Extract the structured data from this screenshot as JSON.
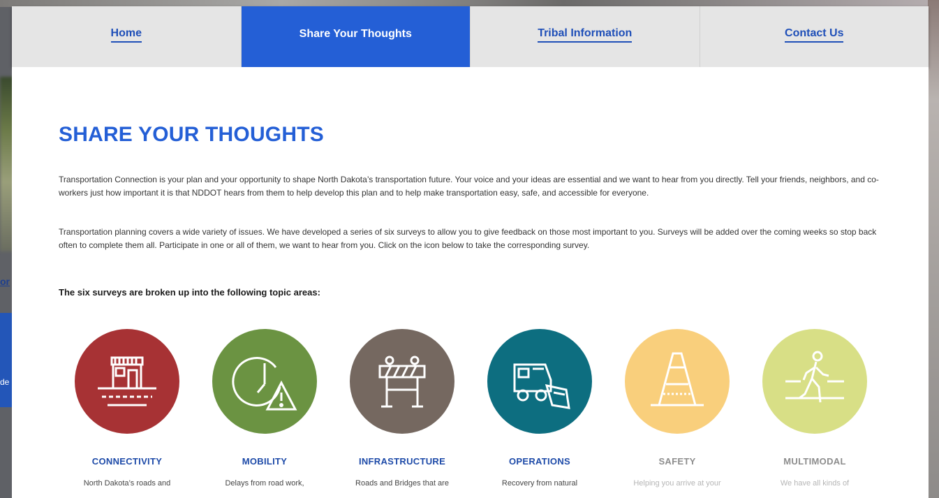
{
  "nav": {
    "items": [
      {
        "label": "Home",
        "active": false
      },
      {
        "label": "Share Your Thoughts",
        "active": true
      },
      {
        "label": "Tribal Information",
        "active": false
      },
      {
        "label": "Contact Us",
        "active": false
      }
    ]
  },
  "main": {
    "title": "SHARE YOUR THOUGHTS",
    "paragraph1": "Transportation Connection is your plan and your opportunity to shape North Dakota’s transportation future. Your voice and your ideas are essential and we want to hear from you directly. Tell your friends, neighbors, and co-workers just how important it is that NDDOT hears from them to help develop this plan and to help make transportation easy, safe, and accessible for everyone.",
    "paragraph2": "Transportation planning covers a wide variety of issues. We have developed a series of six surveys to allow you to give feedback on those most important to you. Surveys will be added over the coming weeks so stop back often to complete them all. Participate in one or all of them, we want to hear from you. Click on the icon below to take the corresponding survey.",
    "subheading": "The six surveys are broken up into the following topic areas:"
  },
  "topics": [
    {
      "title": "CONNECTIVITY",
      "desc": "North Dakota’s roads and",
      "icon": "storefront-icon",
      "color": "#a73234",
      "title_color": "#1d4aa8"
    },
    {
      "title": "MOBILITY",
      "desc": "Delays from road work,",
      "icon": "clock-warning-icon",
      "color": "#6b9342",
      "title_color": "#1d4aa8"
    },
    {
      "title": "INFRASTRUCTURE",
      "desc": "Roads and Bridges that are",
      "icon": "road-barrier-icon",
      "color": "#756860",
      "title_color": "#1d4aa8"
    },
    {
      "title": "OPERATIONS",
      "desc": "Recovery from natural",
      "icon": "snowplow-icon",
      "color": "#0d6e80",
      "title_color": "#1d4aa8"
    },
    {
      "title": "SAFETY",
      "desc": "Helping you arrive at your",
      "icon": "traffic-cone-icon",
      "color": "#f9cf7c",
      "title_color": "#8d8d8d"
    },
    {
      "title": "MULTIMODAL",
      "desc": "We have all kinds of",
      "icon": "pedestrian-icon",
      "color": "#d8df86",
      "title_color": "#8d8d8d"
    }
  ],
  "background": {
    "left_link_fragment": "or",
    "left_text_fragment": "de"
  }
}
